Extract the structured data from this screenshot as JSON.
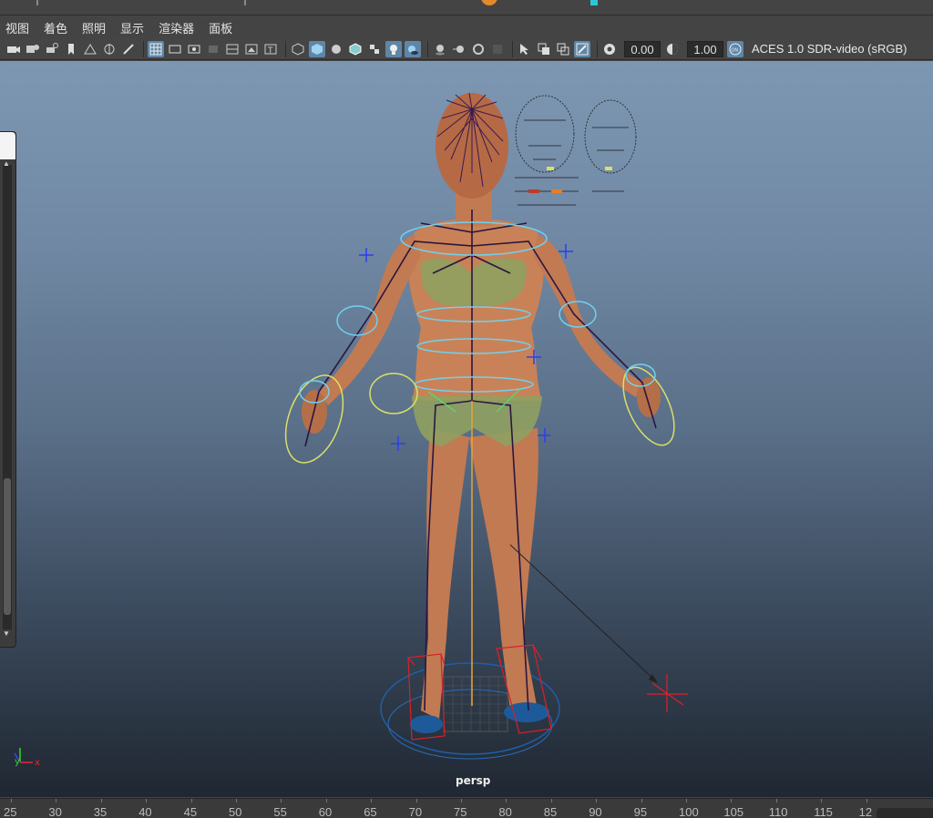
{
  "menubar": {
    "items": [
      "视图",
      "着色",
      "照明",
      "显示",
      "渲染器",
      "面板"
    ]
  },
  "toolbar": {
    "exposure_value": "0.00",
    "gamma_value": "1.00",
    "color_space": "ACES 1.0 SDR-video (sRGB)",
    "icons": [
      "camera-icon",
      "camera-attributes-icon",
      "bookmark-icon",
      "image-plane-icon",
      "grid-icon",
      "film-gate-icon",
      "resolution-gate-icon",
      "wireframe-icon",
      "smooth-shade-icon",
      "textured-icon",
      "lights-icon",
      "shadows-icon",
      "isolate-select-icon",
      "xray-icon",
      "exposure-icon",
      "gamma-icon",
      "color-management-icon"
    ],
    "accent_color": "#5f86a8"
  },
  "viewport": {
    "camera_label": "persp",
    "axis": {
      "y": "y",
      "x": "x"
    }
  },
  "timeline": {
    "ticks": [
      "25",
      "30",
      "35",
      "40",
      "45",
      "50",
      "55",
      "60",
      "65",
      "70",
      "75",
      "80",
      "85",
      "90",
      "95",
      "100",
      "105",
      "110",
      "115",
      "12"
    ]
  }
}
